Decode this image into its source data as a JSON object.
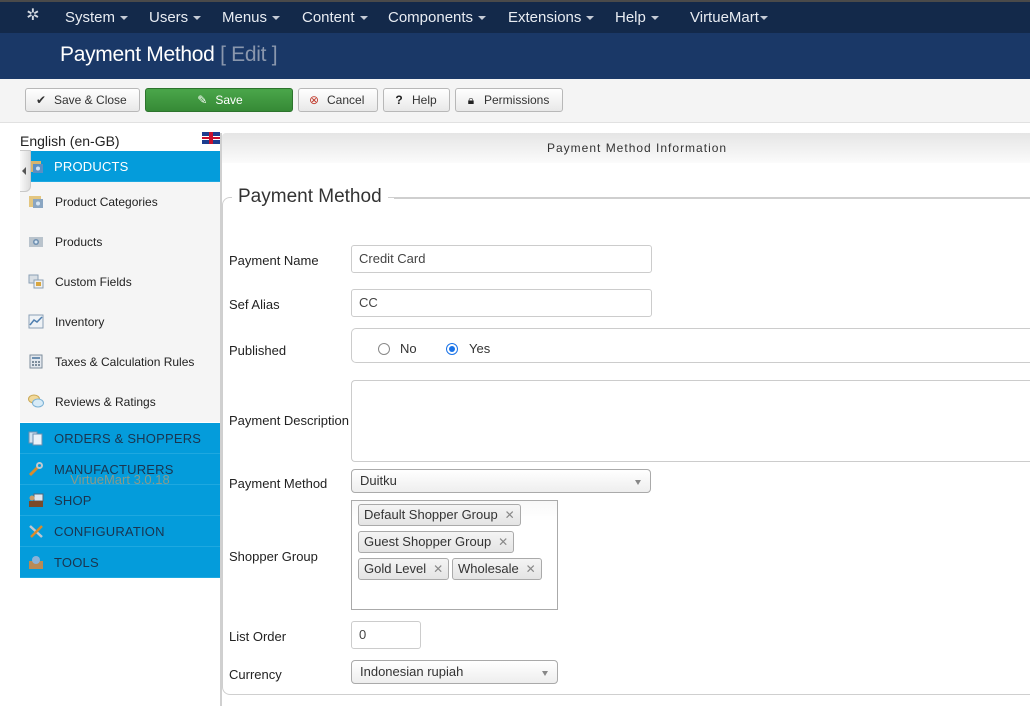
{
  "navbar": {
    "logo_icon": "joomla-icon",
    "menus": [
      "System",
      "Users",
      "Menus",
      "Content",
      "Components",
      "Extensions",
      "Help",
      "VirtueMart"
    ]
  },
  "titlebar": {
    "title": "Payment Method",
    "subtitle": "[ Edit ]"
  },
  "toolbar": {
    "save_close": {
      "label": "Save & Close",
      "icon": "check-icon"
    },
    "save": {
      "label": "Save",
      "icon": "edit-icon"
    },
    "cancel": {
      "label": "Cancel",
      "icon": "cancel-circle-icon"
    },
    "help": {
      "label": "Help",
      "icon": "question-circle-icon"
    },
    "permissions": {
      "label": "Permissions",
      "icon": "lock-icon"
    }
  },
  "sidebar": {
    "language": "English (en-GB)",
    "flag_icon": "uk-flag-icon",
    "products_header": "PRODUCTS",
    "product_items": [
      {
        "label": "Product Categories",
        "icon": "folder-camera-icon"
      },
      {
        "label": "Products",
        "icon": "camera-icon"
      },
      {
        "label": "Custom Fields",
        "icon": "custom-fields-icon"
      },
      {
        "label": "Inventory",
        "icon": "chart-icon"
      },
      {
        "label": "Taxes & Calculation Rules",
        "icon": "calculator-icon"
      },
      {
        "label": "Reviews & Ratings",
        "icon": "speech-bubbles-icon"
      }
    ],
    "sections": [
      {
        "label": "ORDERS & SHOPPERS",
        "icon": "documents-icon"
      },
      {
        "label": "MANUFACTURERS",
        "icon": "wrench-icon"
      },
      {
        "label": "SHOP",
        "icon": "shop-icon"
      },
      {
        "label": "CONFIGURATION",
        "icon": "tools-icon"
      },
      {
        "label": "TOOLS",
        "icon": "toolbox-icon"
      }
    ],
    "version": "VirtueMart 3.0.18"
  },
  "main": {
    "tab_title": "Payment Method Information",
    "legend": "Payment Method",
    "fields": {
      "payment_name": {
        "label": "Payment Name",
        "value": "Credit Card"
      },
      "sef_alias": {
        "label": "Sef Alias",
        "value": "CC"
      },
      "published": {
        "label": "Published",
        "options": [
          "No",
          "Yes"
        ],
        "selected": "Yes"
      },
      "payment_description": {
        "label": "Payment Description",
        "value": ""
      },
      "payment_method": {
        "label": "Payment Method",
        "value": "Duitku"
      },
      "shopper_group": {
        "label": "Shopper Group",
        "values": [
          "Default Shopper Group",
          "Guest Shopper Group",
          "Gold Level",
          "Wholesale"
        ]
      },
      "list_order": {
        "label": "List Order",
        "value": "0"
      },
      "currency": {
        "label": "Currency",
        "value": "Indonesian rupiah"
      }
    }
  }
}
